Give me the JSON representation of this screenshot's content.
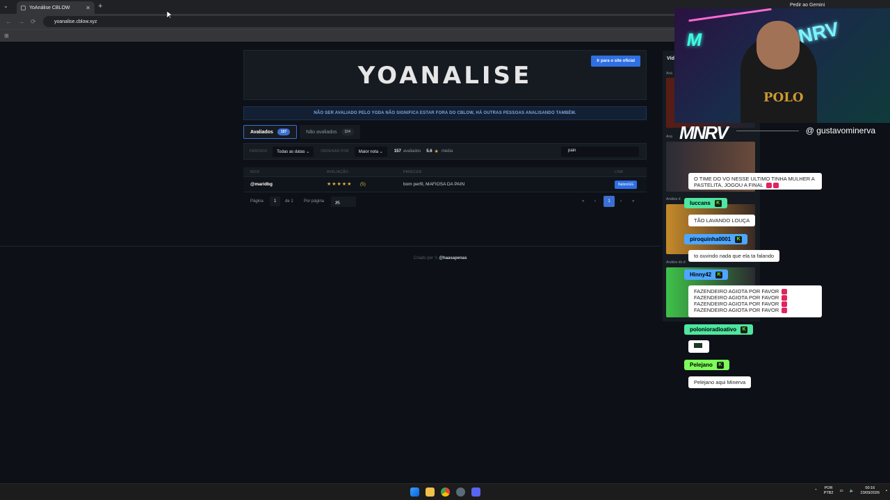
{
  "browser": {
    "tab_title": "YoAnálise CBLOW",
    "tab_close": "✕",
    "new_tab": "+",
    "tab_menu": "⌄",
    "url": "yoanalise.cblow.xyz",
    "gemini": "Pedir ao Gemini",
    "nav_back": "←",
    "nav_forward": "→",
    "nav_reload": "⟳",
    "apps_icon": "⊞"
  },
  "page": {
    "logo": "YOANALISE",
    "site_button": "Ir para o site oficial",
    "notice": "NÃO SER AVALIADO PELO YODA NÃO SIGNIFICA ESTAR FORA DO CBLOW, HÁ OUTRAS PESSOAS ANALISANDO TAMBÉM.",
    "tabs": [
      {
        "label": "Avaliados",
        "count": "157"
      },
      {
        "label": "Não avaliados",
        "count": "324"
      }
    ],
    "filters": {
      "period_label": "PERÍODO",
      "period_value": "Todas as datas",
      "order_label": "ORDENAR POR",
      "order_value": "Maior nota",
      "evaluated_count": "157",
      "evaluated_text": "avaliados",
      "average": "5.6",
      "average_text": "média",
      "search_value": "pain"
    },
    "table": {
      "headers": [
        "NICK",
        "AVALIAÇÃO",
        "PARECER",
        "LINK"
      ],
      "rows": [
        {
          "nick": "@maridbg",
          "stars": "★★★★★",
          "rating": "(5)",
          "opinion": "bom perfil, MAFIOSA DA PAIN",
          "link": "NationGG"
        }
      ]
    },
    "pager": {
      "page_label": "Página",
      "page": "1",
      "of_text": "de 1",
      "per_page_label": "Por página",
      "per_page": "25",
      "first": "«",
      "prev": "‹",
      "current": "1",
      "next": "›",
      "last": "»"
    },
    "footer": {
      "created_by": "Criado por",
      "author": "@haasapenas"
    },
    "sidebar": {
      "title": "Víd",
      "labels": [
        "Aná",
        "Aná",
        "Análise d",
        "Análise do d"
      ]
    }
  },
  "stream": {
    "brand": "MNRV",
    "handle": "@ gustavominerva",
    "cam_text_1": "M",
    "cam_text_2": "MNRV",
    "shirt_text": "POLO",
    "chat": [
      {
        "type": "msg",
        "text": "O TIME DO VO NESSE ULTIMO TINHA MULHER A PASTELITA, JOGOU A FINAL"
      },
      {
        "type": "name",
        "name": "luccans",
        "color": "#4ee6a0"
      },
      {
        "type": "msg",
        "text": "TÃO LAVANDO LOUÇA"
      },
      {
        "type": "name",
        "name": "piroquinha0001",
        "color": "#4da6ff"
      },
      {
        "type": "msg",
        "text": "to ouvindo nada que ela ta falando"
      },
      {
        "type": "name",
        "name": "Hinny42",
        "color": "#4da6ff"
      },
      {
        "type": "msg",
        "text": "FAZENDEIRO AGIOTA POR FAVOR"
      },
      {
        "type": "name",
        "name": "polonioradioativo",
        "color": "#4ee6a0"
      },
      {
        "type": "name",
        "name": "Pelejano",
        "color": "#7dfc5a"
      },
      {
        "type": "msg",
        "text": "Pelejano aqui Minerva"
      }
    ]
  },
  "taskbar": {
    "lang_1": "POR",
    "lang_2": "PTB2",
    "time": "00:16",
    "date": "23/09/2026"
  }
}
